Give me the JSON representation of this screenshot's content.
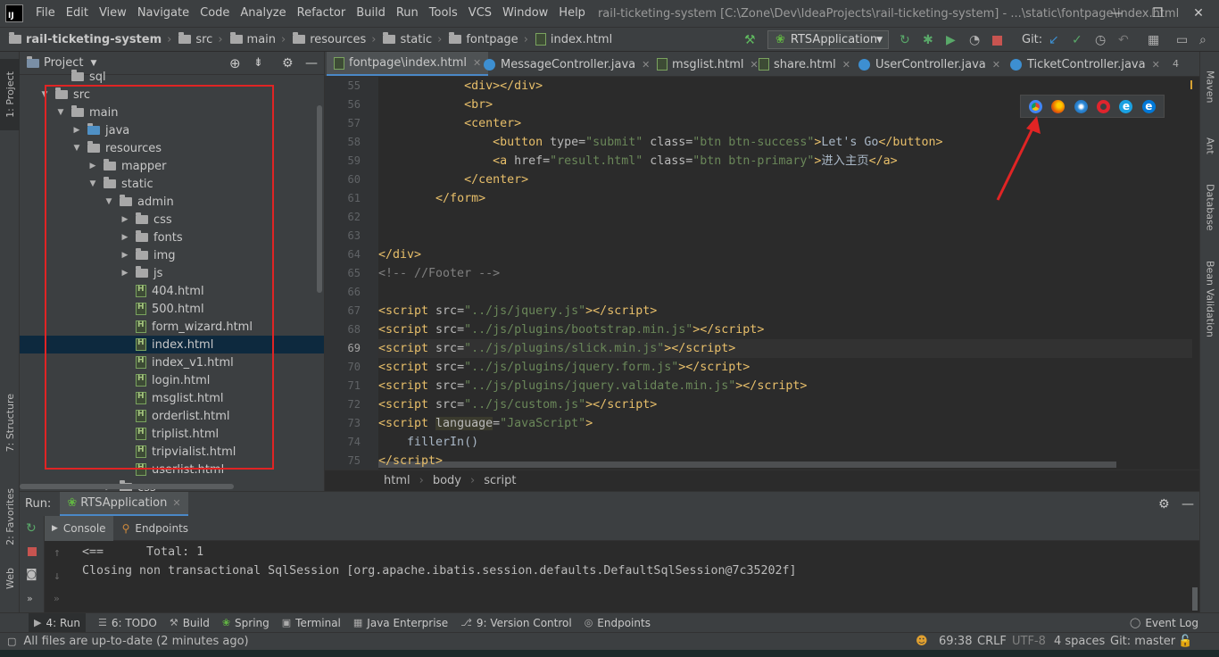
{
  "menubar": {
    "logo_text": "IJ",
    "items": [
      "File",
      "Edit",
      "View",
      "Navigate",
      "Code",
      "Analyze",
      "Refactor",
      "Build",
      "Run",
      "Tools",
      "VCS",
      "Window",
      "Help"
    ],
    "window_title": "rail-ticketing-system [C:\\Zone\\Dev\\IdeaProjects\\rail-ticketing-system] - ...\\static\\fontpage\\index.html"
  },
  "navbar": {
    "crumbs": [
      "rail-ticketing-system",
      "src",
      "main",
      "resources",
      "static",
      "fontpage",
      "index.html"
    ],
    "run_config": "RTSApplication",
    "git_label": "Git:"
  },
  "left_strip": {
    "tabs": [
      "1: Project",
      "7: Structure",
      "2: Favorites",
      "Web"
    ]
  },
  "project": {
    "header_label": "Project",
    "tree": [
      {
        "label": "sql",
        "type": "folder",
        "depth": 2,
        "arrow": ""
      },
      {
        "label": "src",
        "type": "folder",
        "depth": 1,
        "arrow": "▼"
      },
      {
        "label": "main",
        "type": "folder",
        "depth": 2,
        "arrow": "▼"
      },
      {
        "label": "java",
        "type": "java-folder",
        "depth": 3,
        "arrow": "▶"
      },
      {
        "label": "resources",
        "type": "folder",
        "depth": 3,
        "arrow": "▼"
      },
      {
        "label": "mapper",
        "type": "folder",
        "depth": 4,
        "arrow": "▶"
      },
      {
        "label": "static",
        "type": "folder",
        "depth": 4,
        "arrow": "▼"
      },
      {
        "label": "admin",
        "type": "folder",
        "depth": 5,
        "arrow": "▼"
      },
      {
        "label": "css",
        "type": "folder",
        "depth": 6,
        "arrow": "▶"
      },
      {
        "label": "fonts",
        "type": "folder",
        "depth": 6,
        "arrow": "▶"
      },
      {
        "label": "img",
        "type": "folder",
        "depth": 6,
        "arrow": "▶"
      },
      {
        "label": "js",
        "type": "folder",
        "depth": 6,
        "arrow": "▶"
      },
      {
        "label": "404.html",
        "type": "html",
        "depth": 6,
        "arrow": ""
      },
      {
        "label": "500.html",
        "type": "html",
        "depth": 6,
        "arrow": ""
      },
      {
        "label": "form_wizard.html",
        "type": "html",
        "depth": 6,
        "arrow": ""
      },
      {
        "label": "index.html",
        "type": "html",
        "depth": 6,
        "arrow": "",
        "selected": true
      },
      {
        "label": "index_v1.html",
        "type": "html",
        "depth": 6,
        "arrow": ""
      },
      {
        "label": "login.html",
        "type": "html",
        "depth": 6,
        "arrow": ""
      },
      {
        "label": "msglist.html",
        "type": "html",
        "depth": 6,
        "arrow": ""
      },
      {
        "label": "orderlist.html",
        "type": "html",
        "depth": 6,
        "arrow": ""
      },
      {
        "label": "triplist.html",
        "type": "html",
        "depth": 6,
        "arrow": ""
      },
      {
        "label": "tripvialist.html",
        "type": "html",
        "depth": 6,
        "arrow": ""
      },
      {
        "label": "userlist.html",
        "type": "html",
        "depth": 6,
        "arrow": ""
      },
      {
        "label": "css",
        "type": "folder",
        "depth": 5,
        "arrow": "▶"
      }
    ]
  },
  "editor": {
    "tabs": [
      {
        "label": "fontpage\\index.html",
        "type": "html",
        "active": true
      },
      {
        "label": "MessageController.java",
        "type": "class"
      },
      {
        "label": "msglist.html",
        "type": "html"
      },
      {
        "label": "share.html",
        "type": "html"
      },
      {
        "label": "UserController.java",
        "type": "class"
      },
      {
        "label": "TicketController.java",
        "type": "class"
      }
    ],
    "tab_overflow": "4",
    "lines": [
      {
        "n": "55",
        "html": "            <span class='tg'>&lt;div&gt;&lt;/div&gt;</span>"
      },
      {
        "n": "56",
        "html": "            <span class='tg'>&lt;br&gt;</span>"
      },
      {
        "n": "57",
        "html": "            <span class='tg'>&lt;center&gt;</span>"
      },
      {
        "n": "58",
        "html": "                <span class='tg'>&lt;button </span><span class='at'>type=</span><span class='st'>\"submit\"</span><span class='at'> class=</span><span class='st'>\"btn btn-success\"</span><span class='tg'>&gt;</span>Let's Go<span class='tg'>&lt;/button&gt;</span>"
      },
      {
        "n": "59",
        "html": "                <span class='tg'>&lt;a </span><span class='at'>href=</span><span class='st'>\"result.html\"</span><span class='at'> class=</span><span class='st'>\"btn btn-primary\"</span><span class='tg'>&gt;</span>进入主页<span class='tg'>&lt;/a&gt;</span>"
      },
      {
        "n": "60",
        "html": "            <span class='tg'>&lt;/center&gt;</span>"
      },
      {
        "n": "61",
        "html": "        <span class='tg'>&lt;/form&gt;</span>"
      },
      {
        "n": "62",
        "html": ""
      },
      {
        "n": "63",
        "html": ""
      },
      {
        "n": "64",
        "html": "<span class='tg'>&lt;/div&gt;</span>"
      },
      {
        "n": "65",
        "html": "<span class='cm'>&lt;!-- //Footer --&gt;</span>"
      },
      {
        "n": "66",
        "html": ""
      },
      {
        "n": "67",
        "html": "<span class='tg'>&lt;script </span><span class='at'>src=</span><span class='st'>\"../js/jquery.js\"</span><span class='tg'>&gt;&lt;/script&gt;</span>"
      },
      {
        "n": "68",
        "html": "<span class='tg'>&lt;script </span><span class='at'>src=</span><span class='st'>\"../js/plugins/bootstrap.min.js\"</span><span class='tg'>&gt;&lt;/script&gt;</span>"
      },
      {
        "n": "69",
        "html": "<span class='tg'>&lt;script </span><span class='at'>src=</span><span class='st'>\"../js/plugins/slick.min.js\"</span><span class='tg'>&gt;&lt;/script&gt;</span>",
        "current": true
      },
      {
        "n": "70",
        "html": "<span class='tg'>&lt;script </span><span class='at'>src=</span><span class='st'>\"../js/plugins/jquery.form.js\"</span><span class='tg'>&gt;&lt;/script&gt;</span>"
      },
      {
        "n": "71",
        "html": "<span class='tg'>&lt;script </span><span class='at'>src=</span><span class='st'>\"../js/plugins/jquery.validate.min.js\"</span><span class='tg'>&gt;&lt;/script&gt;</span>"
      },
      {
        "n": "72",
        "html": "<span class='tg'>&lt;script </span><span class='at'>src=</span><span class='st'>\"../js/custom.js\"</span><span class='tg'>&gt;&lt;/script&gt;</span>"
      },
      {
        "n": "73",
        "html": "<span class='tg'>&lt;script </span><span class='at' style='background:#3b3b2e'>language</span><span class='at'>=</span><span class='st'>\"JavaScript\"</span><span class='tg'>&gt;</span>"
      },
      {
        "n": "74",
        "html": "    fillerIn()"
      },
      {
        "n": "75",
        "html": "<span class='tg'>&lt;/script&gt;</span>"
      }
    ],
    "breadcrumbs": [
      "html",
      "body",
      "script"
    ]
  },
  "right_strip": {
    "tabs": [
      "Maven",
      "Ant",
      "Database",
      "Bean Validation"
    ]
  },
  "run": {
    "label": "Run:",
    "config_tab": "RTSApplication",
    "subtabs": [
      "Console",
      "Endpoints"
    ],
    "console_lines": [
      "<==      Total: 1",
      "Closing non transactional SqlSession [org.apache.ibatis.session.defaults.DefaultSqlSession@7c35202f]"
    ]
  },
  "toolwin_bar": {
    "items": [
      "4: Run",
      "6: TODO",
      "Build",
      "Spring",
      "Terminal",
      "Java Enterprise",
      "9: Version Control",
      "Endpoints"
    ],
    "right_item": "Event Log"
  },
  "statusbar": {
    "message": "All files are up-to-date (2 minutes ago)",
    "position": "69:38",
    "line_sep": "CRLF",
    "encoding": "UTF-8",
    "indent": "4 spaces",
    "git": "Git: master"
  },
  "colors": {
    "accent": "#4a88c7",
    "annotation_red": "#e02424"
  }
}
